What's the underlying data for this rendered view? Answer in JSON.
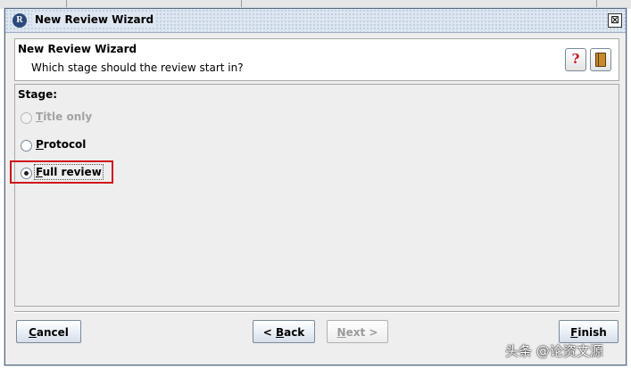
{
  "window": {
    "title": "New Review Wizard",
    "app_icon": "R",
    "close_glyph": "⊠"
  },
  "header": {
    "title": "New Review Wizard",
    "subtitle": "Which stage should the review start in?",
    "help_icon": "question-mark-icon",
    "help_glyph": "?",
    "book_icon": "book-icon"
  },
  "stage": {
    "label": "Stage:",
    "options": [
      {
        "mnemonic": "T",
        "rest": "itle only",
        "checked": false,
        "enabled": false
      },
      {
        "mnemonic": "P",
        "rest": "rotocol",
        "checked": false,
        "enabled": true
      },
      {
        "mnemonic": "F",
        "rest": "ull review",
        "checked": true,
        "enabled": true
      }
    ],
    "highlight_color": "#d0131a"
  },
  "buttons": {
    "cancel": {
      "mnemonic": "C",
      "rest": "ancel",
      "enabled": true
    },
    "back": {
      "prefix": "< ",
      "mnemonic": "B",
      "rest": "ack",
      "enabled": true
    },
    "next": {
      "mnemonic": "N",
      "rest": "ext >",
      "enabled": false
    },
    "finish": {
      "mnemonic": "F",
      "rest": "inish",
      "enabled": true
    }
  },
  "watermark": "头条 @论资文源"
}
